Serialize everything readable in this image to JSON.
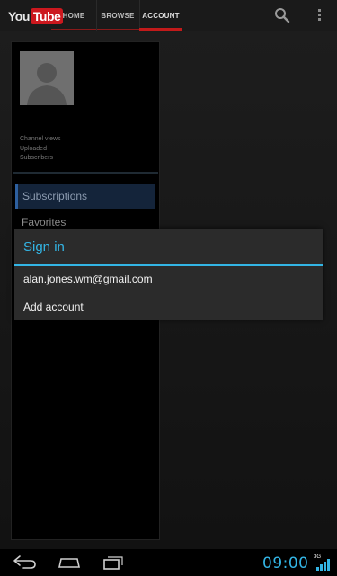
{
  "app": {
    "logo_you": "You",
    "logo_tube": "Tube",
    "brand_color": "#cc181e"
  },
  "tabs": [
    {
      "label": "HOME"
    },
    {
      "label": "BROWSE"
    },
    {
      "label": "ACCOUNT",
      "active": true
    }
  ],
  "toolbar": {
    "search_icon": "search-icon",
    "menu_icon": "overflow-menu-icon"
  },
  "profile": {
    "stats": [
      "Channel views",
      "Uploaded",
      "Subscribers"
    ]
  },
  "sidebar": {
    "items": [
      {
        "label": "Subscriptions",
        "selected": true
      },
      {
        "label": "Favorites"
      }
    ]
  },
  "dialog": {
    "title": "Sign in",
    "accent_color": "#33b5e5",
    "options": [
      {
        "label": "alan.jones.wm@gmail.com"
      },
      {
        "label": "Add account"
      }
    ]
  },
  "statusbar": {
    "time": "09:00",
    "network": "3G"
  }
}
